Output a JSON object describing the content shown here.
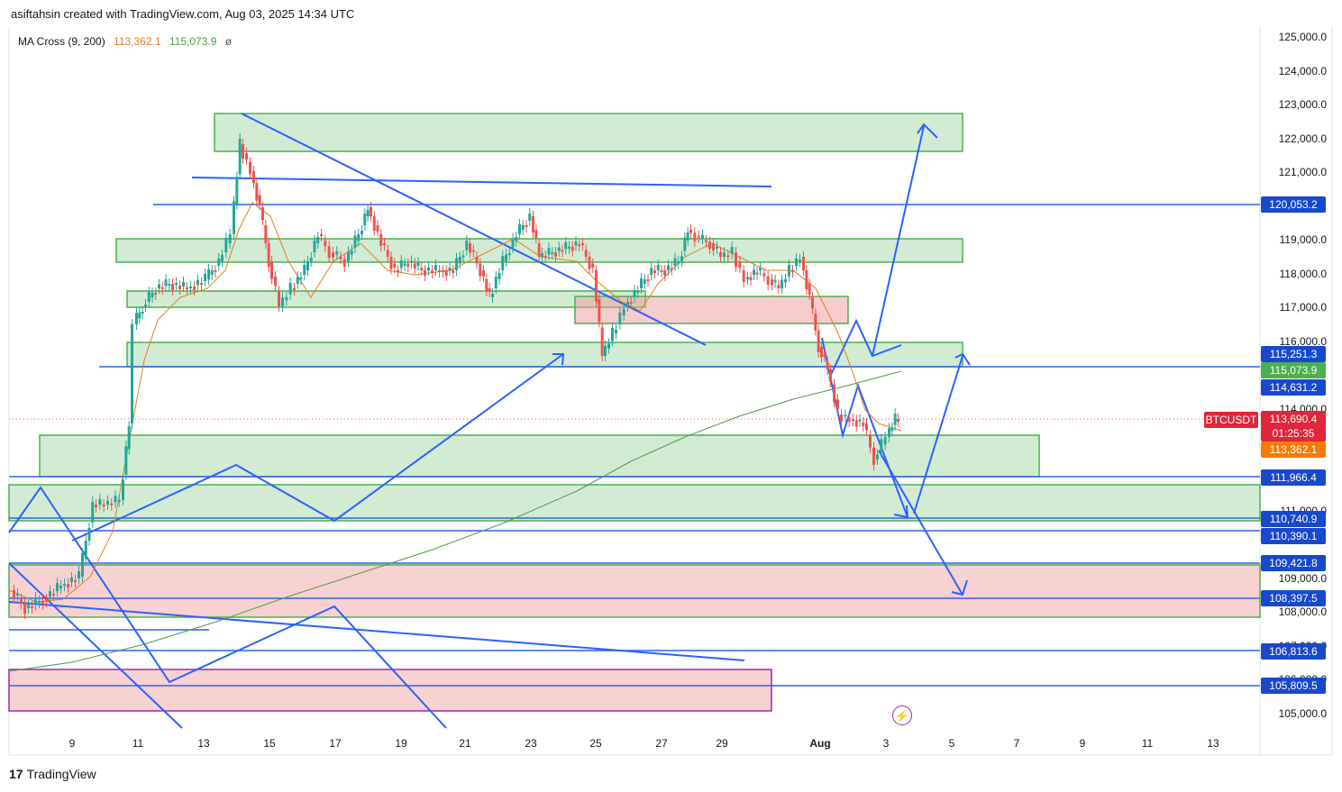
{
  "header": {
    "attribution": "asiftahsin created with TradingView.com, Aug 03, 2025 14:34 UTC"
  },
  "indicator": {
    "name": "MA Cross (9, 200)",
    "ma_fast": "113,362.1",
    "ma_slow": "115,073.9",
    "eye": "ø"
  },
  "symbol": "BTCUSDT",
  "footer": {
    "brand": "TradingView",
    "logo": "17"
  },
  "colors": {
    "green_zone": "#4caf50",
    "red_zone": "#ef9a9a",
    "blue_line": "#2962ff",
    "up": "#26a69a",
    "down": "#ef5350",
    "ma_fast": "#e0801f",
    "ma_slow": "#4c9a48",
    "tag_green": "#4caf50",
    "tag_red": "#e0263a",
    "tag_orange": "#f57c00",
    "tag_blue": "#1848cc"
  },
  "price_axis": [
    "125,000.0",
    "124,000.0",
    "123,000.0",
    "122,000.0",
    "121,000.0",
    "119,000.0",
    "118,000.0",
    "117,000.0",
    "116,000.0",
    "114,000.0",
    "111,000.0",
    "109,000.0",
    "108,000.0",
    "105,000.0",
    "107,000.0",
    "106,000.0"
  ],
  "price_tags": {
    "t120053": "120,053.2",
    "t115251": "115,251.3",
    "t115073": "115,073.9",
    "t114631": "114,631.2",
    "t113690": "113,690.4",
    "countdown": "01:25:35",
    "t113362": "113,362.1",
    "t111966": "111,966.4",
    "t110740": "110,740.9",
    "t110390": "110,390.1",
    "t109421": "109,421.8",
    "t108397": "108,397.5",
    "t106813": "106,813.6",
    "t105809": "105,809.5"
  },
  "time_axis": [
    "9",
    "11",
    "13",
    "15",
    "17",
    "19",
    "21",
    "23",
    "25",
    "27",
    "29",
    "Aug",
    "3",
    "5",
    "7",
    "9",
    "11",
    "13"
  ],
  "chart_data": {
    "type": "candlestick",
    "symbol": "BTCUSDT",
    "indicators": [
      {
        "name": "MA Cross (9, 200)",
        "values": [
          113362.1,
          115073.9
        ]
      }
    ],
    "ylim": [
      105000,
      125000
    ],
    "key_levels": [
      120053.2,
      115251.3,
      114631.2,
      111966.4,
      110740.9,
      110390.1,
      109421.8,
      108397.5,
      106813.6,
      105809.5
    ],
    "last_price": 113690.4
  }
}
